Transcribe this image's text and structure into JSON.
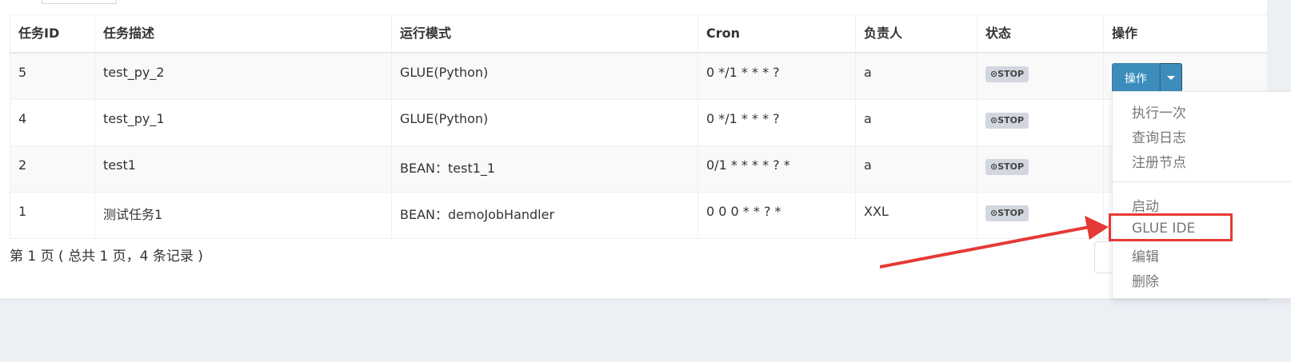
{
  "table": {
    "headers": [
      "任务ID",
      "任务描述",
      "运行模式",
      "Cron",
      "负责人",
      "状态",
      "操作"
    ],
    "rows": [
      {
        "id": "5",
        "desc": "test_py_2",
        "mode": "GLUE(Python)",
        "cron": "0 */1 * * * ?",
        "owner": "a",
        "status": "⊙STOP"
      },
      {
        "id": "4",
        "desc": "test_py_1",
        "mode": "GLUE(Python)",
        "cron": "0 */1 * * * ?",
        "owner": "a",
        "status": "⊙STOP"
      },
      {
        "id": "2",
        "desc": "test1",
        "mode": "BEAN：test1_1",
        "cron": "0/1 * * * * ? *",
        "owner": "a",
        "status": "⊙STOP"
      },
      {
        "id": "1",
        "desc": "测试任务1",
        "mode": "BEAN：demoJobHandler",
        "cron": "0 0 0 * * ? *",
        "owner": "XXL",
        "status": "⊙STOP"
      }
    ],
    "action_label": "操作"
  },
  "pager": {
    "summary": "第 1 页 ( 总共 1 页，4 条记录 )"
  },
  "dropdown": {
    "items": [
      "执行一次",
      "查询日志",
      "注册节点",
      "启动",
      "GLUE IDE",
      "编辑",
      "删除"
    ]
  },
  "annotation": {
    "color": "#e53935"
  }
}
